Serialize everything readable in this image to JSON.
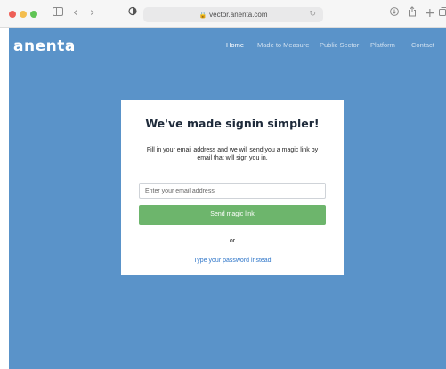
{
  "browser": {
    "url": "vector.anenta.com",
    "icons": {
      "sidebar": "sidebar-icon",
      "back": "chevron-left-icon",
      "forward": "chevron-right-icon",
      "privacy": "shield-icon",
      "lock": "lock-icon",
      "reload": "reload-icon",
      "download": "download-icon",
      "share": "share-icon",
      "new_tab": "plus-icon",
      "tabs": "tabs-icon"
    }
  },
  "site": {
    "logo": "anenta",
    "nav": {
      "home": "Home",
      "made_to_measure": "Made to Measure",
      "public_sector": "Public Sector",
      "platform": "Platform",
      "contact": "Contact"
    }
  },
  "signin": {
    "title": "We've made signin simpler!",
    "description": "Fill in your email address and we will send you a magic link by email that will sign you in.",
    "email_placeholder": "Enter your email address",
    "email_value": "",
    "submit_label": "Send magic link",
    "or": "or",
    "password_link": "Type your password instead"
  },
  "colors": {
    "page_background": "#5a93c9",
    "button": "#6db56c",
    "link": "#2f76c9"
  }
}
